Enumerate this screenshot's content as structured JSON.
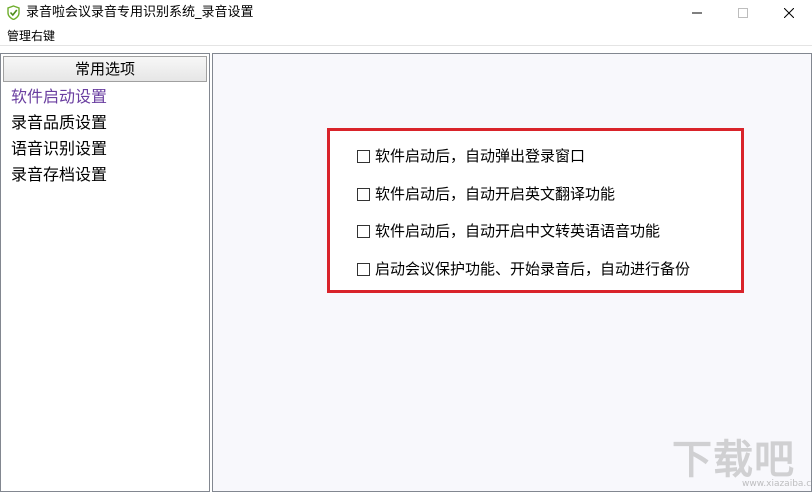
{
  "window": {
    "title": "录音啦会议录音专用识别系统_录音设置",
    "icon": "green-check-shield-icon"
  },
  "window_controls": {
    "minimize_icon": "minimize-icon",
    "maximize_icon": "maximize-icon",
    "close_icon": "close-icon"
  },
  "menubar": {
    "item": "管理右键"
  },
  "sidebar": {
    "header": "常用选项",
    "items": [
      {
        "label": "软件启动设置",
        "selected": true
      },
      {
        "label": "录音品质设置",
        "selected": false
      },
      {
        "label": "语音识别设置",
        "selected": false
      },
      {
        "label": "录音存档设置",
        "selected": false
      }
    ],
    "selected_color": "#6a3ea0"
  },
  "options": [
    {
      "label": "软件启动后，自动弹出登录窗口",
      "checked": false
    },
    {
      "label": "软件启动后，自动开启英文翻译功能",
      "checked": false
    },
    {
      "label": "软件启动后，自动开启中文转英语语音功能",
      "checked": false
    },
    {
      "label": "启动会议保护功能、开始录音后，自动进行备份",
      "checked": false
    }
  ],
  "highlight_color": "#d9232a",
  "watermark": {
    "text": "下载吧",
    "url": "www.xiazaiba.com"
  }
}
